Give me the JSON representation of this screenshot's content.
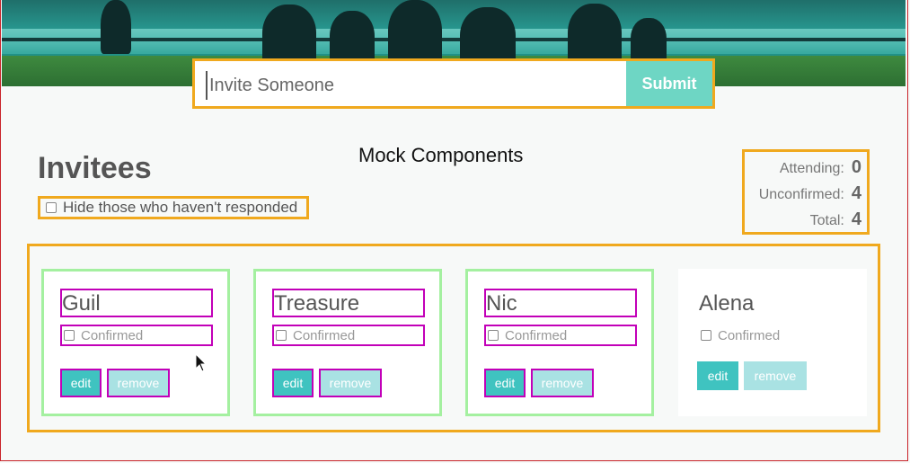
{
  "search": {
    "placeholder": "Invite Someone",
    "submit_label": "Submit"
  },
  "mock_label": "Mock Components",
  "page_title": "Invitees",
  "filter": {
    "label": "Hide those who haven't responded"
  },
  "counts": [
    {
      "label": "Attending:",
      "value": "0"
    },
    {
      "label": "Unconfirmed:",
      "value": "4"
    },
    {
      "label": "Total:",
      "value": "4"
    }
  ],
  "invitees": [
    {
      "name": "Guil",
      "confirmed_label": "Confirmed",
      "edit_label": "edit",
      "remove_label": "remove"
    },
    {
      "name": "Treasure",
      "confirmed_label": "Confirmed",
      "edit_label": "edit",
      "remove_label": "remove"
    },
    {
      "name": "Nic",
      "confirmed_label": "Confirmed",
      "edit_label": "edit",
      "remove_label": "remove"
    },
    {
      "name": "Alena",
      "confirmed_label": "Confirmed",
      "edit_label": "edit",
      "remove_label": "remove"
    }
  ],
  "colors": {
    "highlight_orange": "#f0a91e",
    "highlight_green": "#a4f0a0",
    "highlight_magenta": "#c200b8",
    "accent_teal": "#6ed6c4"
  }
}
